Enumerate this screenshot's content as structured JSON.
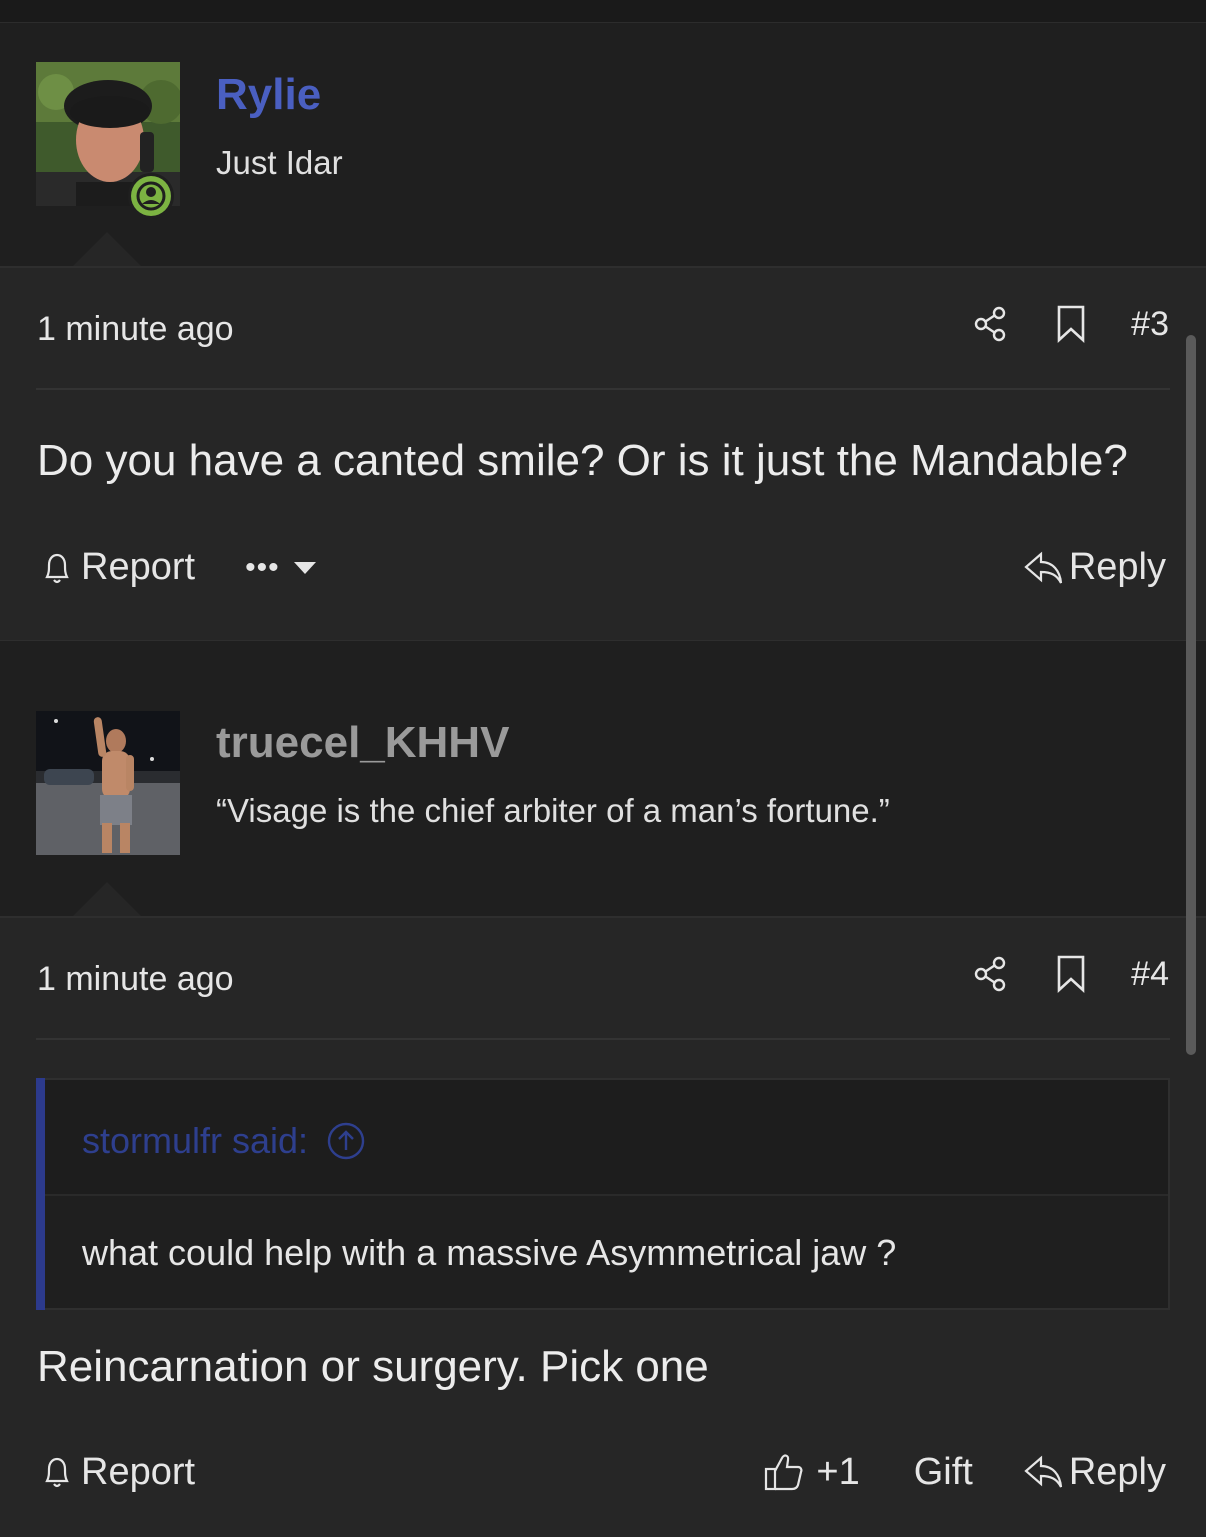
{
  "posts": [
    {
      "username": "Rylie",
      "user_title": "Just Idar",
      "time": "1 minute ago",
      "post_number": "#3",
      "message": "Do you have a canted smile? Or is it just the Mandable?",
      "actions": {
        "report": "Report",
        "more": "•••",
        "reply": "Reply"
      }
    },
    {
      "username": "truecel_KHHV",
      "user_title": "“Visage is the chief arbiter of a man’s fortune.”",
      "time": "1 minute ago",
      "post_number": "#4",
      "quote": {
        "author": "stormulfr said:",
        "text": "what could help with a massive Asymmetrical jaw ?"
      },
      "message": "Reincarnation or surgery. Pick one",
      "actions": {
        "report": "Report",
        "like": "+1",
        "gift": "Gift",
        "reply": "Reply"
      }
    }
  ],
  "colors": {
    "background": "#1f1f1f",
    "post_background": "#262626",
    "username_staff": "#4a5fc1",
    "username_regular": "#9a9a9a",
    "online": "#7cb342",
    "quote_accent": "#2c3a8c"
  },
  "icons": [
    "user-online-icon",
    "share-icon",
    "bookmark-icon",
    "bell-icon",
    "caret-down-icon",
    "reply-icon",
    "thumbs-up-icon",
    "arrow-up-circle-icon"
  ]
}
